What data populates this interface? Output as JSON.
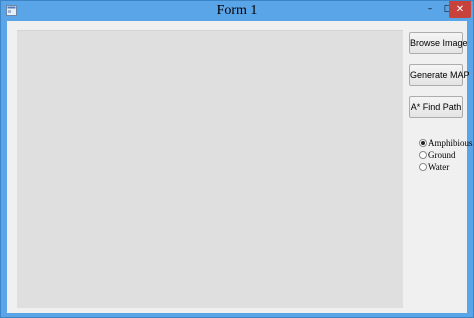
{
  "window": {
    "title": "Form 1",
    "controls": {
      "minimize": "–",
      "maximize": "□",
      "close": "✕"
    },
    "accent_color": "#5aa5e8",
    "close_color": "#c7423b"
  },
  "buttons": {
    "browse": "Browse Image",
    "generate": "Generate MAP",
    "find_path": "A* Find Path"
  },
  "radios": {
    "options": [
      "Amphibious",
      "Ground",
      "Water"
    ],
    "selected": "Amphibious"
  },
  "icons": {
    "app": "form-app-icon",
    "radio_checked": "radio-checked",
    "radio_unchecked": "radio-unchecked"
  }
}
